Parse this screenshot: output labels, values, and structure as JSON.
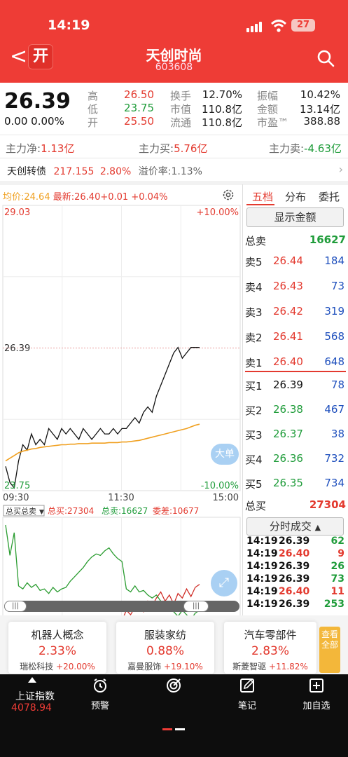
{
  "status": {
    "time": "14:19",
    "battery": "27"
  },
  "header": {
    "kai_label": "开",
    "name": "天创时尚",
    "code": "603608"
  },
  "quote": {
    "price": "26.39",
    "change": "0.00 0.00%",
    "rows": [
      {
        "k1": "高",
        "v1": "26.50",
        "k2": "换手",
        "v2": "12.70%",
        "k3": "振幅",
        "v3": "10.42%"
      },
      {
        "k1": "低",
        "v1": "23.75",
        "k2": "市值",
        "v2": "110.8亿",
        "k3": "金额",
        "v3": "13.14亿"
      },
      {
        "k1": "开",
        "v1": "25.50",
        "k2": "流通",
        "v2": "110.8亿",
        "k3": "市盈™",
        "v3": "388.88"
      }
    ]
  },
  "flow": {
    "net_label": "主力净:",
    "net_value": "1.13亿",
    "buy_label": "主力买:",
    "buy_value": "5.76亿",
    "sell_label": "主力卖:",
    "sell_value": "-4.63亿"
  },
  "convertible": {
    "name": "天创转债",
    "price": "217.155",
    "pct": "2.80%",
    "premium": "溢价率:1.13%"
  },
  "chart_legend": {
    "avg": "均价:24.64",
    "latest": "最新:26.40",
    "chg": "+0.01",
    "pct": "+0.04%"
  },
  "chart_data": [
    {
      "type": "line",
      "y_top_label": "29.03",
      "y_bottom_label": "23.75",
      "pct_top": "+10.00%",
      "pct_bottom": "-10.00%",
      "ref_price_label": "26.39",
      "ylim": [
        23.75,
        29.03
      ],
      "x_ticks": [
        "09:30",
        "11:30",
        "15:00"
      ],
      "series": [
        {
          "name": "最新",
          "color": "#111111",
          "values": [
            24.2,
            23.9,
            23.8,
            24.3,
            24.6,
            24.5,
            24.8,
            24.6,
            24.7,
            24.6,
            24.9,
            24.8,
            24.7,
            24.9,
            24.8,
            24.9,
            24.8,
            24.7,
            24.9,
            24.8,
            24.7,
            24.8,
            24.9,
            24.8,
            24.8,
            24.9,
            24.8,
            24.9,
            24.9,
            25.0,
            25.1,
            25.0,
            25.2,
            25.3,
            25.2,
            25.5,
            25.7,
            25.9,
            26.1,
            26.3,
            26.4,
            26.2,
            26.3,
            26.4,
            26.4,
            26.4
          ]
        },
        {
          "name": "均价",
          "color": "#f0a020",
          "values": [
            24.3,
            24.35,
            24.4,
            24.45,
            24.48,
            24.5,
            24.52,
            24.53,
            24.55,
            24.56,
            24.57,
            24.58,
            24.59,
            24.6,
            24.6,
            24.61,
            24.61,
            24.62,
            24.62,
            24.62,
            24.63,
            24.63,
            24.63,
            24.63,
            24.64,
            24.64,
            24.64,
            24.65,
            24.65,
            24.66,
            24.67,
            24.68,
            24.7,
            24.72,
            24.74,
            24.76,
            24.78,
            24.8,
            24.82,
            24.84,
            24.86,
            24.88,
            24.9,
            24.93,
            24.96,
            24.98
          ]
        }
      ]
    },
    {
      "type": "line",
      "legend": "总买总卖",
      "legend_buy": "总买:27304",
      "legend_sell": "总卖:16627",
      "legend_diff": "委差:10677",
      "series": [
        {
          "name": "总买",
          "color": "#d0302a",
          "values": [
            15000,
            12000,
            14500,
            16500,
            17000,
            16500,
            17200,
            16800,
            17500,
            17000,
            17800,
            17200,
            18000,
            17500,
            18200,
            18000,
            18500,
            18100,
            18800,
            19000,
            18600,
            19200,
            19000,
            19400,
            19800,
            19500,
            20000,
            19700,
            20400,
            20100,
            20600,
            20800,
            20300,
            21000,
            20700,
            21200,
            21600,
            21000,
            21400,
            20800,
            21500,
            21200,
            21800,
            21300,
            21900,
            22100
          ]
        },
        {
          "name": "总卖",
          "color": "#2a9c30",
          "values": [
            26000,
            24000,
            25500,
            22000,
            21800,
            22200,
            21900,
            22100,
            21700,
            21800,
            21500,
            21900,
            21600,
            21800,
            21900,
            22300,
            22600,
            22900,
            23200,
            23600,
            23900,
            24100,
            24000,
            24300,
            24500,
            24100,
            23800,
            23600,
            21800,
            21600,
            22000,
            21600,
            21700,
            21400,
            21200,
            21400,
            21000,
            20900,
            20600,
            20300,
            20000,
            20400,
            20100,
            19800,
            20200,
            20400
          ]
        }
      ]
    }
  ],
  "orderbook": {
    "tabs": [
      "五档",
      "分布",
      "委托"
    ],
    "show_amount": "显示金额",
    "total_sell_label": "总卖",
    "total_sell": "16627",
    "asks": [
      {
        "l": "卖5",
        "p": "26.44",
        "v": "184"
      },
      {
        "l": "卖4",
        "p": "26.43",
        "v": "73"
      },
      {
        "l": "卖3",
        "p": "26.42",
        "v": "319"
      },
      {
        "l": "卖2",
        "p": "26.41",
        "v": "568"
      },
      {
        "l": "卖1",
        "p": "26.40",
        "v": "648"
      }
    ],
    "bids": [
      {
        "l": "买1",
        "p": "26.39",
        "v": "78"
      },
      {
        "l": "买2",
        "p": "26.38",
        "v": "467"
      },
      {
        "l": "买3",
        "p": "26.37",
        "v": "38"
      },
      {
        "l": "买4",
        "p": "26.36",
        "v": "732"
      },
      {
        "l": "买5",
        "p": "26.35",
        "v": "734"
      }
    ],
    "total_buy_label": "总买",
    "total_buy": "27304",
    "fenshi_label": "分时成交",
    "ticks": [
      {
        "t": "14:19",
        "p": "26.39",
        "v": "62",
        "pc": "#111111",
        "vc": "#1f9c3a"
      },
      {
        "t": "14:19",
        "p": "26.40",
        "v": "9",
        "pc": "#e33a2f",
        "vc": "#e33a2f"
      },
      {
        "t": "14:19",
        "p": "26.39",
        "v": "26",
        "pc": "#111111",
        "vc": "#1f9c3a"
      },
      {
        "t": "14:19",
        "p": "26.39",
        "v": "73",
        "pc": "#111111",
        "vc": "#1f9c3a"
      },
      {
        "t": "14:19",
        "p": "26.40",
        "v": "11",
        "pc": "#e33a2f",
        "vc": "#e33a2f"
      },
      {
        "t": "14:19",
        "p": "26.39",
        "v": "253",
        "pc": "#111111",
        "vc": "#1f9c3a"
      }
    ]
  },
  "badges": {
    "dadan": "大单"
  },
  "sectors": [
    {
      "name": "机器人概念",
      "pct": "2.33%",
      "stock": "瑞松科技",
      "spct": "+20.00%"
    },
    {
      "name": "服装家纺",
      "pct": "0.88%",
      "stock": "嘉曼服饰",
      "spct": "+19.10%"
    },
    {
      "name": "汽车零部件",
      "pct": "2.83%",
      "stock": "斯菱智驱",
      "spct": "+11.82%"
    }
  ],
  "view_all": "查看全部",
  "bottom": {
    "index_name": "上证指数",
    "index_value": "4078.94",
    "items": [
      "预警",
      "",
      "笔记",
      "加自选"
    ]
  }
}
